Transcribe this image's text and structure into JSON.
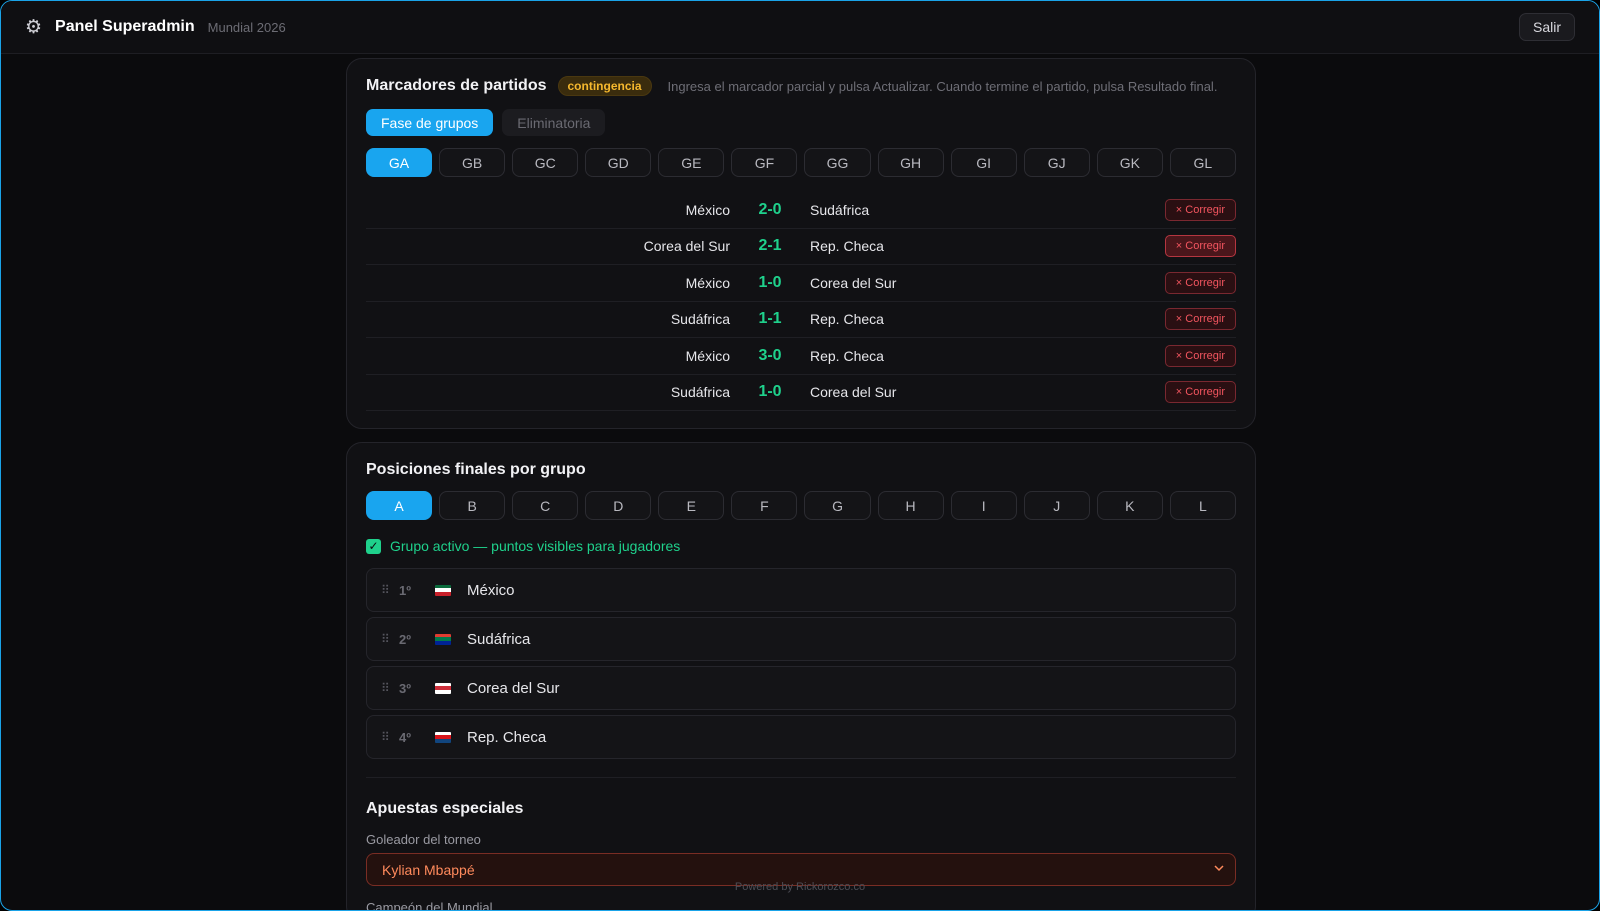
{
  "header": {
    "title": "Panel Superadmin",
    "subtitle": "Mundial 2026",
    "logout_label": "Salir"
  },
  "scores": {
    "title": "Marcadores de partidos",
    "badge": "contingencia",
    "hint": "Ingresa el marcador parcial y pulsa Actualizar. Cuando termine el partido, pulsa Resultado final.",
    "phase_tabs": [
      {
        "label": "Fase de grupos",
        "active": true
      },
      {
        "label": "Eliminatoria",
        "active": false
      }
    ],
    "group_tabs": [
      "GA",
      "GB",
      "GC",
      "GD",
      "GE",
      "GF",
      "GG",
      "GH",
      "GI",
      "GJ",
      "GK",
      "GL"
    ],
    "active_group": "GA",
    "correct_label": "× Corregir",
    "matches": [
      {
        "home": "México",
        "score": "2-0",
        "away": "Sudáfrica"
      },
      {
        "home": "Corea del Sur",
        "score": "2-1",
        "away": "Rep. Checa"
      },
      {
        "home": "México",
        "score": "1-0",
        "away": "Corea del Sur"
      },
      {
        "home": "Sudáfrica",
        "score": "1-1",
        "away": "Rep. Checa"
      },
      {
        "home": "México",
        "score": "3-0",
        "away": "Rep. Checa"
      },
      {
        "home": "Sudáfrica",
        "score": "1-0",
        "away": "Corea del Sur"
      }
    ]
  },
  "positions": {
    "title": "Posiciones finales por grupo",
    "group_tabs": [
      "A",
      "B",
      "C",
      "D",
      "E",
      "F",
      "G",
      "H",
      "I",
      "J",
      "K",
      "L"
    ],
    "active_group": "A",
    "active_label": "Grupo activo — puntos visibles para jugadores",
    "standings": [
      {
        "rank": "1º",
        "team": "México",
        "flag": [
          "#0a6b3c",
          "#ffffff",
          "#c8202a"
        ]
      },
      {
        "rank": "2º",
        "team": "Sudáfrica",
        "flag": [
          "#e03c31",
          "#007a4d",
          "#002395"
        ]
      },
      {
        "rank": "3º",
        "team": "Corea del Sur",
        "flag": [
          "#ffffff",
          "#cd2e3a",
          "#ffffff"
        ]
      },
      {
        "rank": "4º",
        "team": "Rep. Checa",
        "flag": [
          "#ffffff",
          "#d7141a",
          "#11457e"
        ]
      }
    ]
  },
  "special": {
    "title": "Apuestas especiales",
    "scorer_label": "Goleador del torneo",
    "scorer_value": "Kylian Mbappé",
    "champion_label": "Campeón del Mundial"
  },
  "footer": "Powered by Rickorozco.co",
  "colors": {
    "accent": "#19a5ef",
    "score": "#1fd18c",
    "danger": "#f2555f",
    "badge": "#f5b82e"
  }
}
